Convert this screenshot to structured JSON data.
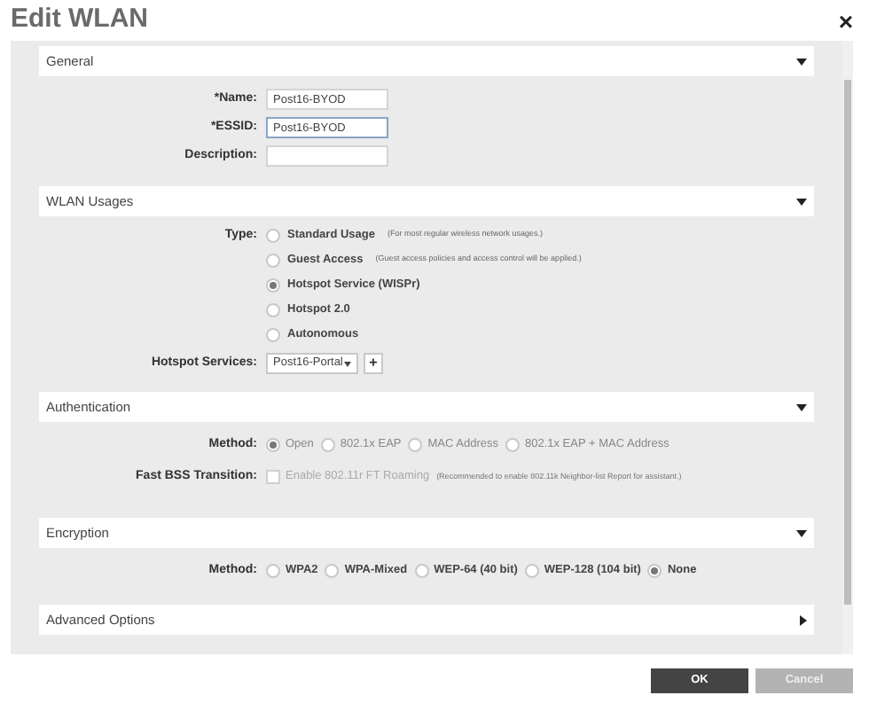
{
  "title": "Edit WLAN",
  "close": "×",
  "sections": [
    {
      "header": "General",
      "expanded": true,
      "rows": [
        {
          "kind": "field",
          "label": "*Name:",
          "value": "Post16-BYOD",
          "focused": false
        },
        {
          "kind": "field",
          "label": "*ESSID:",
          "value": "Post16-BYOD",
          "focused": true
        },
        {
          "kind": "field",
          "label": "Description:",
          "focused": false
        }
      ]
    },
    {
      "header": "WLAN Usages",
      "expanded": true,
      "rows": [
        {
          "kind": "radio_list",
          "label": "Type:",
          "options": [
            {
              "label": "Standard Usage",
              "note": "(For most regular wireless network usages.)",
              "selected": false
            },
            {
              "label": "Guest Access",
              "note": "(Guest access policies and access control will be applied.)",
              "selected": false
            },
            {
              "label": "Hotspot Service (WISPr)",
              "selected": true
            },
            {
              "label": "Hotspot 2.0",
              "selected": false
            },
            {
              "label": "Autonomous",
              "selected": false
            }
          ]
        },
        {
          "kind": "select",
          "label": "Hotspot Services:",
          "value": "Post16-Portal",
          "add": "+"
        }
      ]
    },
    {
      "header": "Authentication",
      "expanded": true,
      "rows": [
        {
          "kind": "radio_row",
          "label": "Method:",
          "options": [
            {
              "label": "Open",
              "selected": true
            },
            {
              "label": "802.1x EAP",
              "selected": false
            },
            {
              "label": "MAC Address",
              "selected": false
            },
            {
              "label": "802.1x EAP + MAC Address",
              "selected": false
            }
          ]
        },
        {
          "kind": "checkbox",
          "label": "Fast BSS Transition:",
          "option": "Enable 802.11r FT Roaming",
          "note": "(Recommended to enable 802.11k Neighbor-list Report for assistant.)",
          "checked": false
        }
      ]
    },
    {
      "header": "Encryption",
      "expanded": true,
      "rows": [
        {
          "kind": "radio_row",
          "label": "Method:",
          "options": [
            {
              "label": "WPA2",
              "selected": false
            },
            {
              "label": "WPA-Mixed",
              "selected": false
            },
            {
              "label": "WEP-64 (40 bit)",
              "selected": false
            },
            {
              "label": "WEP-128 (104 bit)",
              "selected": false
            },
            {
              "label": "None",
              "selected": true
            }
          ]
        }
      ]
    },
    {
      "header": "Advanced Options",
      "expanded": false
    }
  ],
  "buttons": [
    {
      "label": "OK",
      "kind": "primary"
    },
    {
      "label": "Cancel",
      "kind": "secondary"
    }
  ]
}
